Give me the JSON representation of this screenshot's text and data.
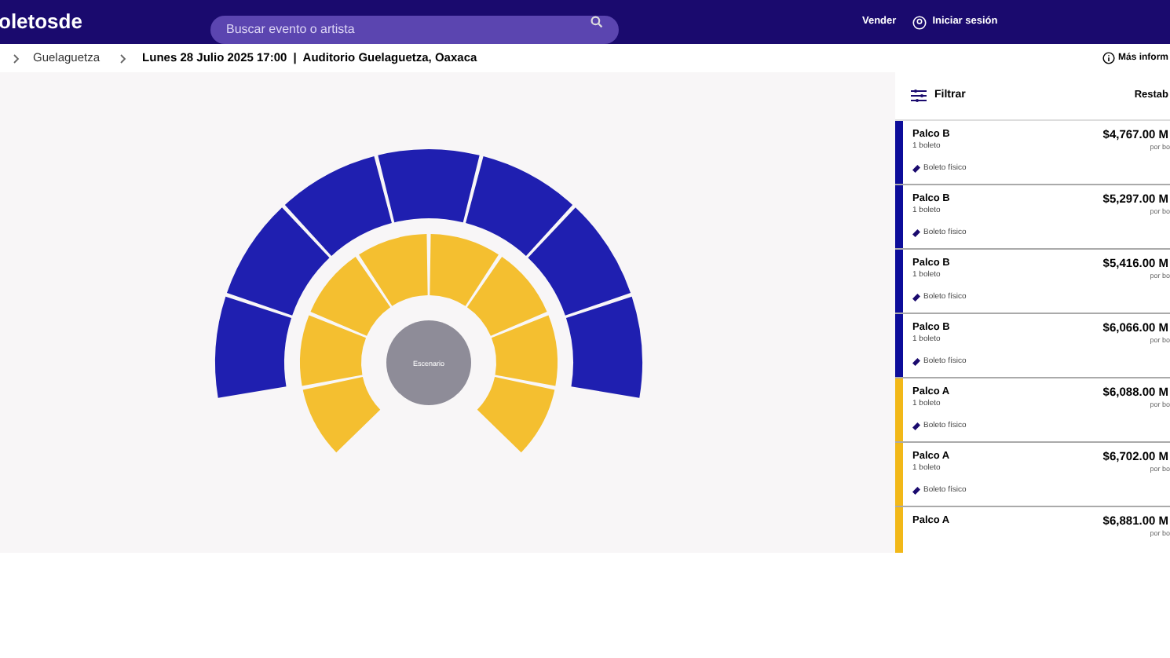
{
  "header": {
    "brand": "oletosde",
    "search": {
      "placeholder": "Buscar evento o artista"
    },
    "sell": "Vender",
    "login": "Iniciar sesión"
  },
  "breadcrumb": {
    "items": [
      "Guelaguetza"
    ],
    "date": "Lunes 28 Julio 2025 17:00",
    "separator": "|",
    "venue": "Auditorio Guelaguetza, Oaxaca",
    "info": "Más inform"
  },
  "map": {
    "stage": "Escenario",
    "rings": [
      {
        "color": "#1f1fb0"
      },
      {
        "color": "#f4bf30"
      }
    ]
  },
  "filter": {
    "label": "Filtrar",
    "reset": "Restab"
  },
  "listings": [
    {
      "section": "Palco B",
      "quantity": "1 boleto",
      "price": "$4,767.00 M",
      "unit": "por bo",
      "delivery": "Boleto físico",
      "color": "#0d0d9a"
    },
    {
      "section": "Palco B",
      "quantity": "1 boleto",
      "price": "$5,297.00 M",
      "unit": "por bo",
      "delivery": "Boleto físico",
      "color": "#0d0d9a"
    },
    {
      "section": "Palco B",
      "quantity": "1 boleto",
      "price": "$5,416.00 M",
      "unit": "por bo",
      "delivery": "Boleto físico",
      "color": "#0d0d9a"
    },
    {
      "section": "Palco B",
      "quantity": "1 boleto",
      "price": "$6,066.00 M",
      "unit": "por bo",
      "delivery": "Boleto físico",
      "color": "#0d0d9a"
    },
    {
      "section": "Palco A",
      "quantity": "1 boleto",
      "price": "$6,088.00 M",
      "unit": "por bo",
      "delivery": "Boleto físico",
      "color": "#f2b818"
    },
    {
      "section": "Palco A",
      "quantity": "1 boleto",
      "price": "$6,702.00 M",
      "unit": "por bo",
      "delivery": "Boleto físico",
      "color": "#f2b818"
    },
    {
      "section": "Palco A",
      "price": "$6,881.00 M",
      "unit": "por bo",
      "color": "#f2b818"
    }
  ]
}
